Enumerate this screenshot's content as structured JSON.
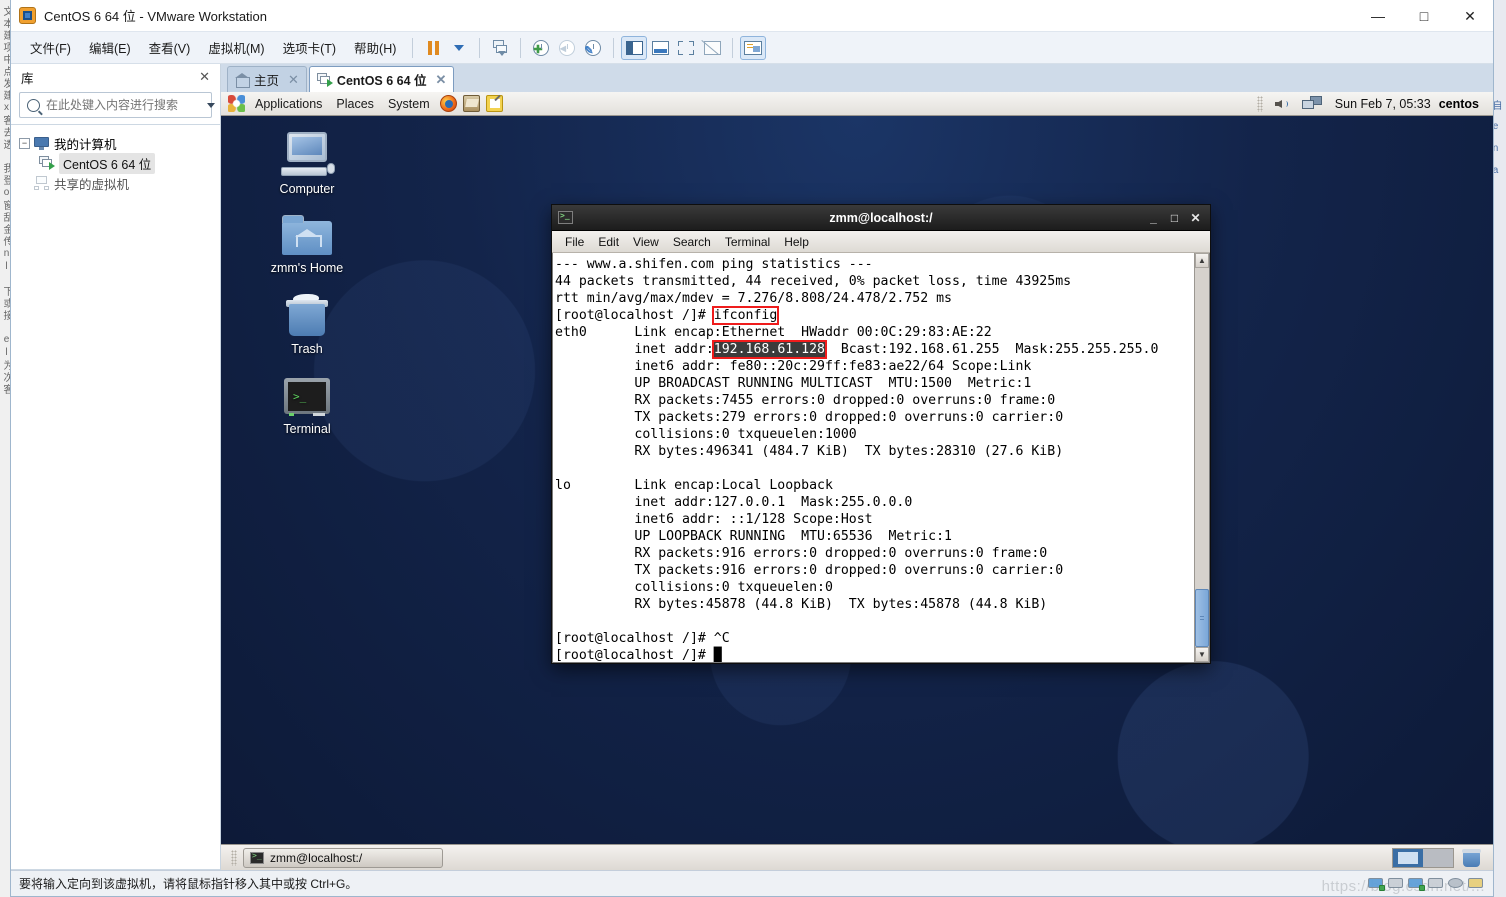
{
  "window": {
    "title": "CentOS 6 64 位 - VMware Workstation",
    "app_icon": "vmware-icon",
    "minimize": "—",
    "maximize": "□",
    "close": "✕"
  },
  "menubar": {
    "items": [
      {
        "label": "文件(F)",
        "name": "menu-file"
      },
      {
        "label": "编辑(E)",
        "name": "menu-edit"
      },
      {
        "label": "查看(V)",
        "name": "menu-view"
      },
      {
        "label": "虚拟机(M)",
        "name": "menu-vm"
      },
      {
        "label": "选项卡(T)",
        "name": "menu-tabs"
      },
      {
        "label": "帮助(H)",
        "name": "menu-help"
      }
    ],
    "toolbar_icons": [
      "pause-icon",
      "dropdown-caret-icon",
      "snapshot-icon",
      "take-snapshot-icon",
      "revert-snapshot-icon",
      "manage-snapshots-icon",
      "show-library-icon",
      "show-console-icon",
      "fullscreen-icon",
      "unity-icon",
      "show-thumbnails-icon"
    ]
  },
  "sidebar": {
    "title": "库",
    "close_label": "✕",
    "search_placeholder": "在此处键入内容进行搜索",
    "search_value": "",
    "tree": [
      {
        "label": "我的计算机",
        "name": "tree-my-computer",
        "expander": "−",
        "icon": "computer-icon",
        "level": 0,
        "selected": false
      },
      {
        "label": "CentOS 6 64 位",
        "name": "tree-centos-vm",
        "expander": "",
        "icon": "virtual-machine-icon",
        "level": 1,
        "selected": true
      },
      {
        "label": "共享的虚拟机",
        "name": "tree-shared-vms",
        "expander": "",
        "icon": "shared-vms-icon",
        "level": 0,
        "selected": false
      }
    ]
  },
  "tabs": [
    {
      "label": "主页",
      "name": "tab-home",
      "icon": "home-icon",
      "active": false,
      "close": "✕"
    },
    {
      "label": "CentOS 6 64 位",
      "name": "tab-centos",
      "icon": "virtual-machine-icon",
      "active": true,
      "close": "✕"
    }
  ],
  "gnome_panel": {
    "menus": [
      "Applications",
      "Places",
      "System"
    ],
    "launchers": [
      "firefox-icon",
      "evolution-icon",
      "gedit-icon"
    ],
    "tray": [
      "volume-icon",
      "network-icon"
    ],
    "clock": "Sun Feb  7, 05:33",
    "user": "centos"
  },
  "desktop": {
    "icons": [
      {
        "label": "Computer",
        "name": "desktop-icon-computer",
        "glyph": "computer-icon"
      },
      {
        "label": "zmm's Home",
        "name": "desktop-icon-home",
        "glyph": "home-folder-icon"
      },
      {
        "label": "Trash",
        "name": "desktop-icon-trash",
        "glyph": "trash-icon"
      },
      {
        "label": "Terminal",
        "name": "desktop-icon-terminal",
        "glyph": "terminal-icon"
      }
    ]
  },
  "terminal": {
    "title": "zmm@localhost:/",
    "icon": "terminal-icon",
    "buttons": {
      "minimize": "_",
      "maximize": "□",
      "close": "✕"
    },
    "menu": [
      "File",
      "Edit",
      "View",
      "Search",
      "Terminal",
      "Help"
    ],
    "lines": [
      "--- www.a.shifen.com ping statistics ---",
      "44 packets transmitted, 44 received, 0% packet loss, time 43925ms",
      "rtt min/avg/max/mdev = 7.276/8.808/24.478/2.752 ms"
    ],
    "cmd_prompt": "[root@localhost /]# ",
    "cmd": "ifconfig",
    "eth0_head_prefix": "eth0      Link encap:Ethernet  HWaddr 00:0C:29:83:AE:22",
    "inet_prefix": "          inet addr:",
    "inet_value": "192.168.61.128",
    "inet_suffix": "  Bcast:192.168.61.255  Mask:255.255.255.0",
    "eth0_rest": [
      "          inet6 addr: fe80::20c:29ff:fe83:ae22/64 Scope:Link",
      "          UP BROADCAST RUNNING MULTICAST  MTU:1500  Metric:1",
      "          RX packets:7455 errors:0 dropped:0 overruns:0 frame:0",
      "          TX packets:279 errors:0 dropped:0 overruns:0 carrier:0",
      "          collisions:0 txqueuelen:1000",
      "          RX bytes:496341 (484.7 KiB)  TX bytes:28310 (27.6 KiB)"
    ],
    "lo_block": [
      "",
      "lo        Link encap:Local Loopback",
      "          inet addr:127.0.0.1  Mask:255.0.0.0",
      "          inet6 addr: ::1/128 Scope:Host",
      "          UP LOOPBACK RUNNING  MTU:65536  Metric:1",
      "          RX packets:916 errors:0 dropped:0 overruns:0 frame:0",
      "          TX packets:916 errors:0 dropped:0 overruns:0 carrier:0",
      "          collisions:0 txqueuelen:0",
      "          RX bytes:45878 (44.8 KiB)  TX bytes:45878 (44.8 KiB)",
      "",
      "[root@localhost /]# ^C"
    ],
    "final_prompt": "[root@localhost /]# ",
    "cursor": "█",
    "scroll_up": "▲",
    "scroll_down": "▼"
  },
  "taskbar": {
    "window_button": "zmm@localhost:/",
    "window_icon": "terminal-icon",
    "workspaces": 2,
    "active_workspace": 1,
    "trash_icon": "trash-icon"
  },
  "statusbar": {
    "hint": "要将输入定向到该虚拟机，请将鼠标指针移入其中或按 Ctrl+G。",
    "devices": [
      "network-device-icon",
      "floppy-device-icon",
      "sound-device-icon",
      "usb-device-icon"
    ],
    "watermark": "https://blog.csdn.net/..."
  },
  "colors": {
    "accent": "#3a6ea5",
    "highlight_box": "#ef1c1c",
    "desktop": "#13244a",
    "terminal_bg": "#ffffff",
    "terminal_fg": "#000000"
  }
}
